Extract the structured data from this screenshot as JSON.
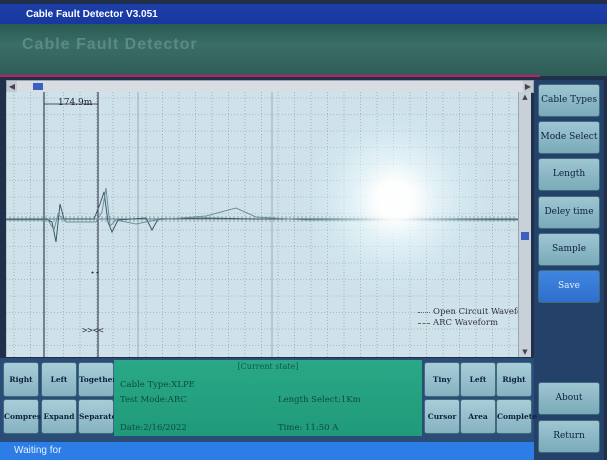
{
  "app": {
    "title": "Cable Fault Detector  V3.051",
    "banner_ghost": "Cable Fault Detector"
  },
  "plot": {
    "cursor_label": "174.9m",
    "cursor_mark": "⋆⋆",
    "compress_mark": ">><<",
    "legend": [
      "Open Circuit Waveform",
      "ARC Waveform"
    ]
  },
  "side_buttons": [
    "Cable Types",
    "Mode Select",
    "Length Select",
    "Deley time",
    "Sample",
    "Save",
    "About",
    "Return"
  ],
  "bottom_buttons": {
    "left": [
      "Right",
      "Left",
      "Together",
      "Compress",
      "Expand",
      "Separate"
    ],
    "right": [
      "Tiny",
      "Left shift",
      "Right shift",
      "Cursor",
      "Area",
      "Complete"
    ]
  },
  "info": {
    "header": "[Current state]",
    "cable_type": "Cable Type:XLPE",
    "test_mode": "Test Mode:ARC",
    "length_select": "Length Select:1Km",
    "date": "Date:2/16/2022",
    "time": "Time: 11:50 A"
  },
  "status": {
    "text": "Waiting for"
  },
  "colors": {
    "titlebar": "#1838a0",
    "plot_bg": "#cfe2ea",
    "active_button": "#2f6fcc",
    "info_panel": "#1f9a7a",
    "statusbar": "#2c7de6",
    "waveform_open": "#3a5a66",
    "waveform_arc": "#6f8f99"
  }
}
